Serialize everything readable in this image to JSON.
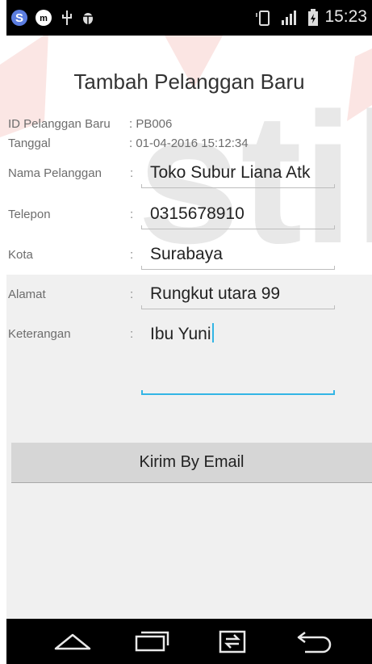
{
  "status_bar": {
    "time": "15:23",
    "icons": [
      "s-app-icon",
      "messenger-icon",
      "usb-icon",
      "android-debug-icon",
      "phone-vibrate-icon",
      "signal-icon",
      "battery-charging-icon"
    ]
  },
  "form": {
    "title": "Tambah Pelanggan Baru",
    "id_label": "ID Pelanggan Baru",
    "id_value": ": PB006",
    "date_label": "Tanggal",
    "date_value": ": 01-04-2016 15:12:34",
    "colon": ":",
    "fields": [
      {
        "label": "Nama Pelanggan",
        "value": "Toko Subur Liana Atk"
      },
      {
        "label": "Telepon",
        "value": "0315678910"
      },
      {
        "label": "Kota",
        "value": "Surabaya"
      },
      {
        "label": "Alamat",
        "value": "Rungkut utara 99"
      },
      {
        "label": "Keterangan",
        "value": "Ibu Yuni"
      }
    ],
    "email_button": "Kirim By Email"
  },
  "nav_bar": {
    "icons": [
      "home-icon",
      "recent-apps-icon",
      "switch-icon",
      "back-icon"
    ]
  },
  "colors": {
    "accent": "#33b5e5",
    "watermark_red": "#d9534f"
  }
}
